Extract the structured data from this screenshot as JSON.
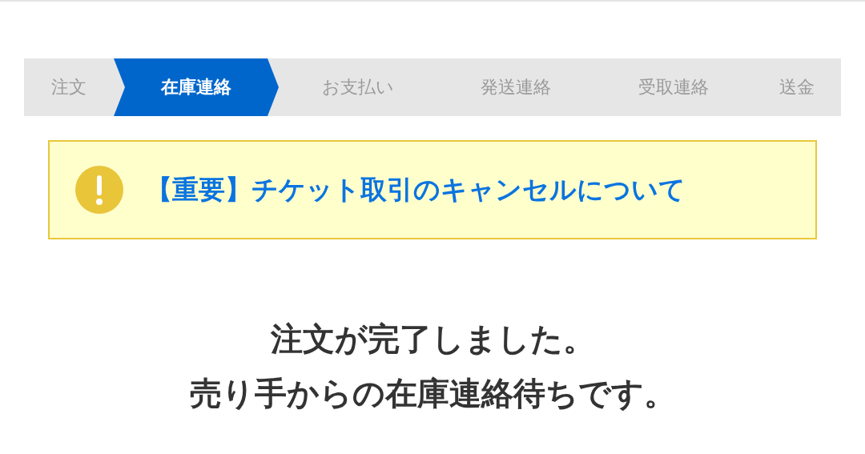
{
  "steps": [
    {
      "label": "注文",
      "selected": false
    },
    {
      "label": "在庫連絡",
      "selected": true
    },
    {
      "label": "お支払い",
      "selected": false
    },
    {
      "label": "発送連絡",
      "selected": false
    },
    {
      "label": "受取連絡",
      "selected": false
    },
    {
      "label": "送金",
      "selected": false
    }
  ],
  "notice": {
    "link": "【重要】チケット取引のキャンセルについて"
  },
  "message": [
    "注文が完了しました。",
    "売り手からの在庫連絡待ちです。"
  ]
}
